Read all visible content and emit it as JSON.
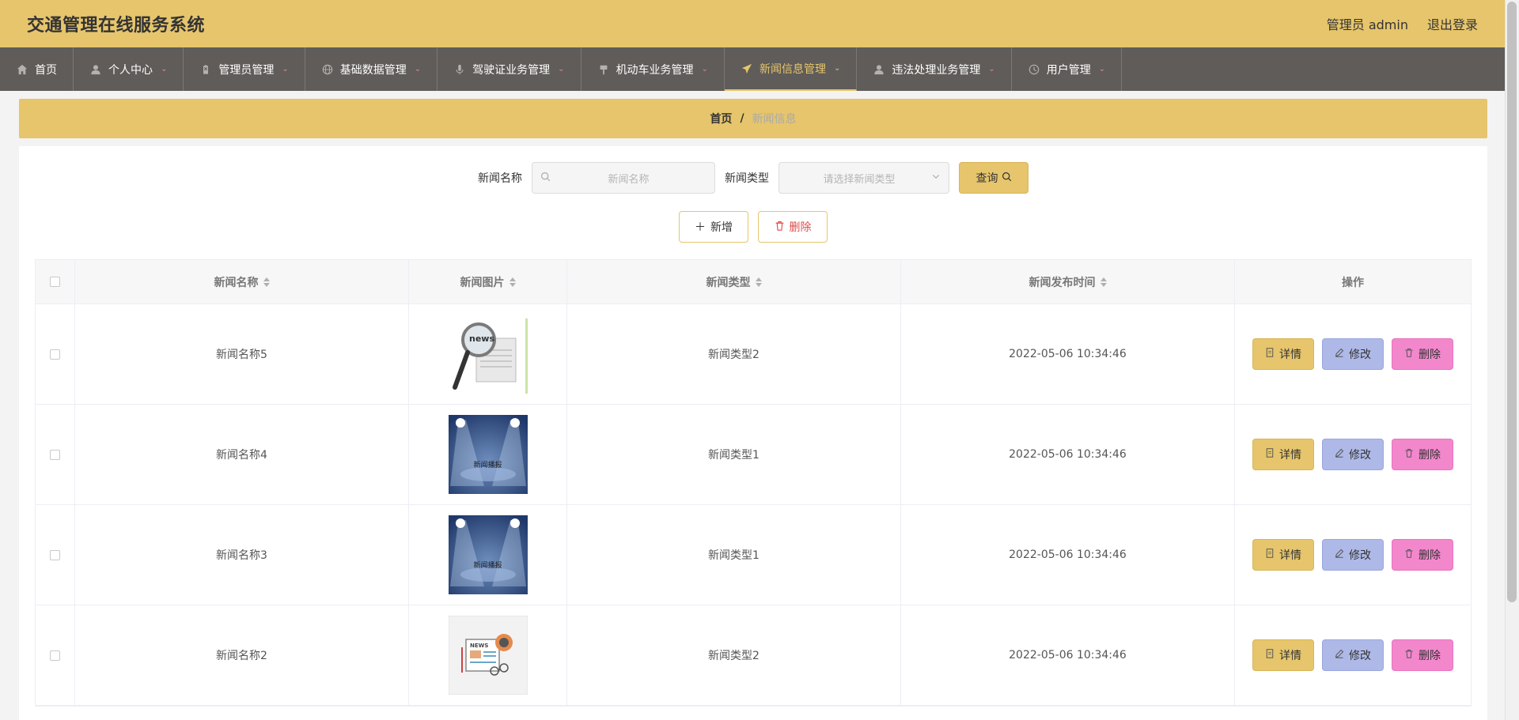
{
  "header": {
    "title": "交通管理在线服务系统",
    "user_label": "管理员 admin",
    "logout_label": "退出登录"
  },
  "nav": {
    "items": [
      {
        "label": "首页",
        "icon": "home-icon",
        "has_dropdown": false
      },
      {
        "label": "个人中心",
        "icon": "user-icon",
        "has_dropdown": true
      },
      {
        "label": "管理员管理",
        "icon": "clipboard-icon",
        "has_dropdown": true
      },
      {
        "label": "基础数据管理",
        "icon": "globe-icon",
        "has_dropdown": true
      },
      {
        "label": "驾驶证业务管理",
        "icon": "microphone-icon",
        "has_dropdown": true
      },
      {
        "label": "机动车业务管理",
        "icon": "flag-icon",
        "has_dropdown": true
      },
      {
        "label": "新闻信息管理",
        "icon": "paper-plane-icon",
        "has_dropdown": true,
        "active": true
      },
      {
        "label": "违法处理业务管理",
        "icon": "user-icon",
        "has_dropdown": true
      },
      {
        "label": "用户管理",
        "icon": "clock-icon",
        "has_dropdown": true
      }
    ]
  },
  "breadcrumb": {
    "home": "首页",
    "separator": "/",
    "current": "新闻信息"
  },
  "search": {
    "name_label": "新闻名称",
    "name_placeholder": "新闻名称",
    "type_label": "新闻类型",
    "type_placeholder": "请选择新闻类型",
    "query_label": "查询"
  },
  "actions": {
    "add_label": "新增",
    "delete_label": "删除"
  },
  "table": {
    "columns": [
      "新闻名称",
      "新闻图片",
      "新闻类型",
      "新闻发布时间",
      "操作"
    ],
    "rows": [
      {
        "name": "新闻名称5",
        "image": "magnifier-news-icon",
        "type": "新闻类型2",
        "time": "2022-05-06 10:34:46"
      },
      {
        "name": "新闻名称4",
        "image": "spotlight-news",
        "image_caption": "新闻播报",
        "type": "新闻类型1",
        "time": "2022-05-06 10:34:46"
      },
      {
        "name": "新闻名称3",
        "image": "spotlight-news",
        "image_caption": "新闻播报",
        "type": "新闻类型1",
        "time": "2022-05-06 10:34:46"
      },
      {
        "name": "新闻名称2",
        "image": "newspaper-icon",
        "type": "新闻类型2",
        "time": "2022-05-06 10:34:46"
      }
    ],
    "op_labels": {
      "detail": "详情",
      "edit": "修改",
      "delete": "删除"
    }
  },
  "colors": {
    "accent": "#e6c56c",
    "nav_bg": "#5f5c59",
    "edit_btn": "#aeb9e8",
    "delete_btn": "#f287cc",
    "delete_text": "#e04b4b"
  }
}
